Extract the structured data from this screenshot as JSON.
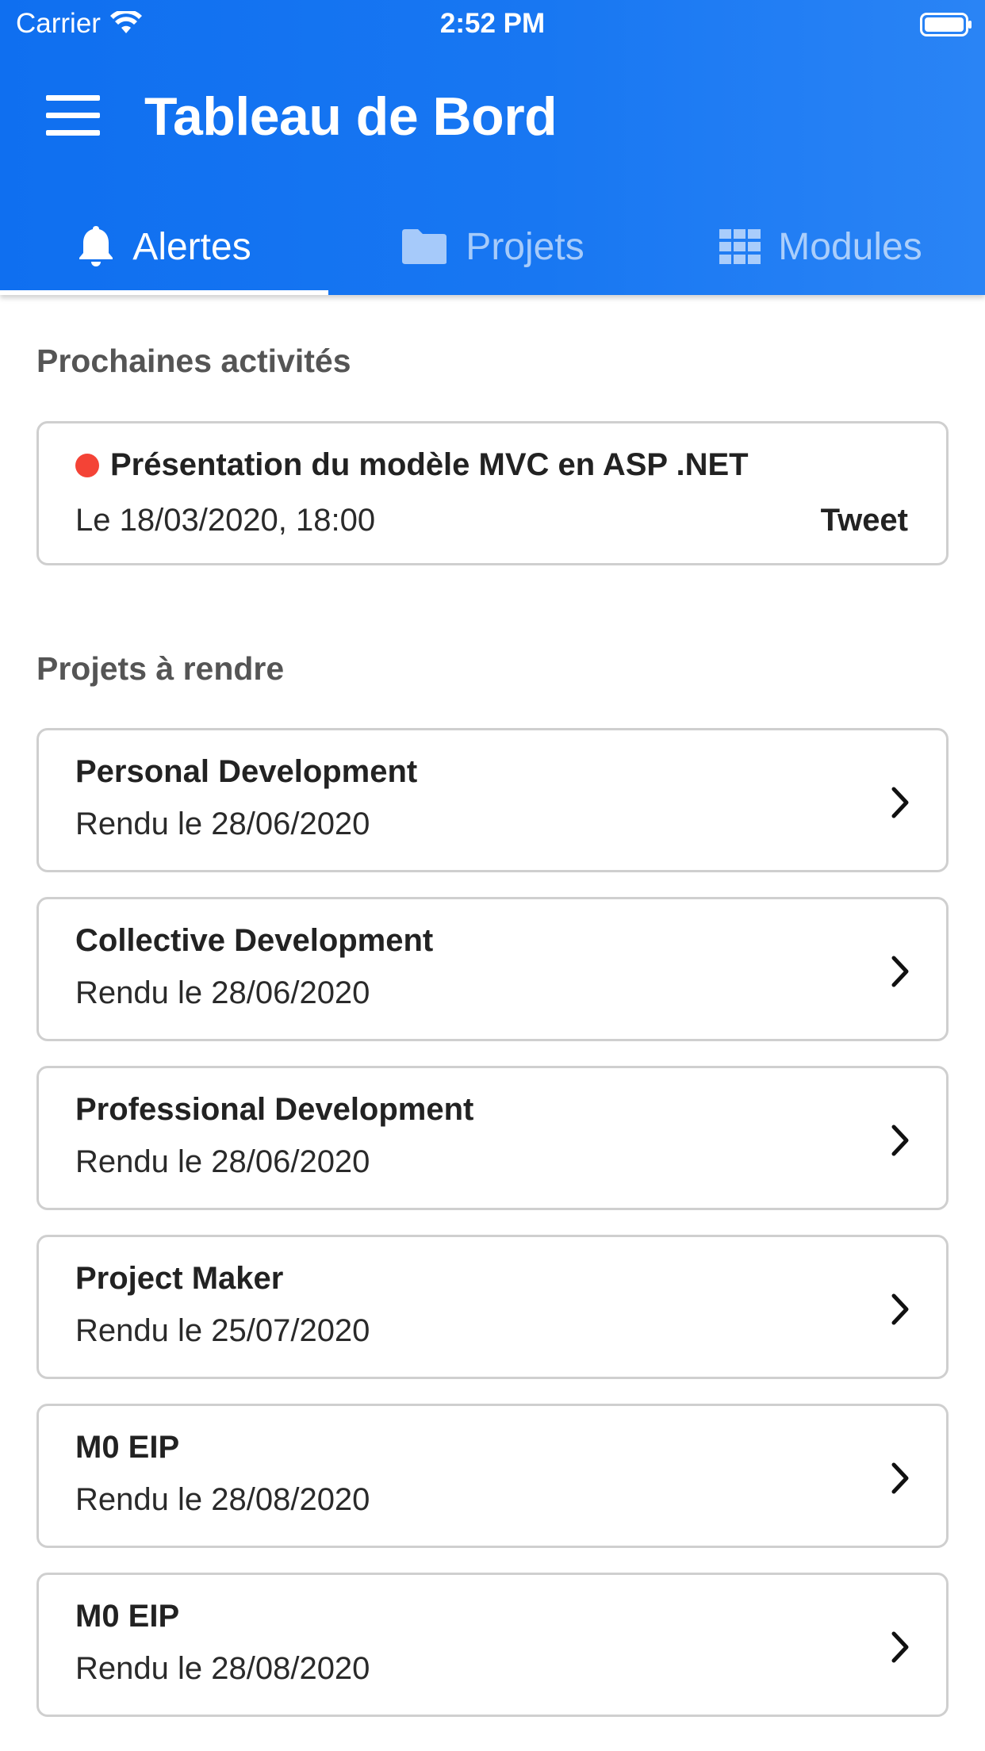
{
  "status_bar": {
    "carrier": "Carrier",
    "time": "2:52 PM"
  },
  "header": {
    "title": "Tableau de Bord",
    "menu_icon": "hamburger-menu-icon"
  },
  "tabs": [
    {
      "label": "Alertes",
      "icon": "bell-icon",
      "active": true
    },
    {
      "label": "Projets",
      "icon": "folder-icon",
      "active": false
    },
    {
      "label": "Modules",
      "icon": "grid-icon",
      "active": false
    }
  ],
  "activities": {
    "section_title": "Prochaines activités",
    "items": [
      {
        "title": "Présentation du modèle MVC en ASP .NET",
        "date": "Le 18/03/2020, 18:00",
        "action": "Tweet"
      }
    ]
  },
  "projects": {
    "section_title": "Projets à rendre",
    "items": [
      {
        "name": "Personal Development",
        "due": "Rendu le 28/06/2020"
      },
      {
        "name": "Collective Development",
        "due": "Rendu le 28/06/2020"
      },
      {
        "name": "Professional Development",
        "due": "Rendu le 28/06/2020"
      },
      {
        "name": "Project Maker",
        "due": "Rendu le 25/07/2020"
      },
      {
        "name": "M0 EIP",
        "due": "Rendu le 28/08/2020"
      },
      {
        "name": "M0 EIP",
        "due": "Rendu le 28/08/2020"
      }
    ]
  },
  "colors": {
    "header_blue": "#1877f2",
    "status_red": "#f44336",
    "section_gray": "#555555"
  }
}
